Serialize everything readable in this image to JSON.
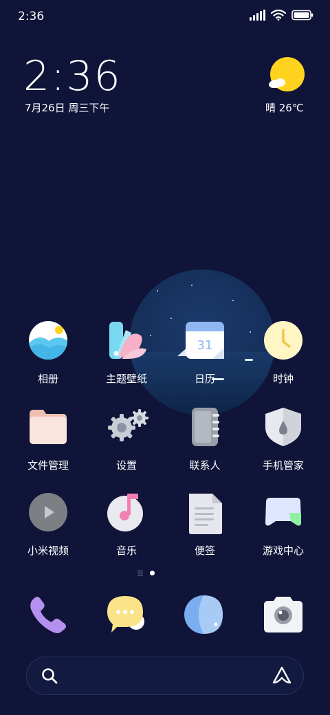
{
  "status_bar": {
    "time": "2:36"
  },
  "clock_widget": {
    "time": "2:36",
    "date": "7月26日 周三下午"
  },
  "weather": {
    "text": "晴 26℃",
    "icon": "sunny-cloud-icon"
  },
  "apps": [
    {
      "label": "相册",
      "icon": "gallery-icon"
    },
    {
      "label": "主题壁纸",
      "icon": "themes-icon"
    },
    {
      "label": "日历",
      "icon": "calendar-icon",
      "badge": "31"
    },
    {
      "label": "时钟",
      "icon": "clock-icon"
    },
    {
      "label": "文件管理",
      "icon": "folder-icon"
    },
    {
      "label": "设置",
      "icon": "settings-gear-icon"
    },
    {
      "label": "联系人",
      "icon": "contacts-icon"
    },
    {
      "label": "手机管家",
      "icon": "security-shield-icon"
    },
    {
      "label": "小米视频",
      "icon": "video-play-icon"
    },
    {
      "label": "音乐",
      "icon": "music-note-icon"
    },
    {
      "label": "便签",
      "icon": "notes-icon"
    },
    {
      "label": "游戏中心",
      "icon": "game-controller-icon"
    }
  ],
  "dock": [
    {
      "icon": "phone-icon"
    },
    {
      "icon": "messages-icon"
    },
    {
      "icon": "browser-icon"
    },
    {
      "icon": "camera-icon"
    }
  ],
  "page_indicator": {
    "current_page": 1,
    "pages": 1
  },
  "colors": {
    "background": "#0f1438",
    "text": "#ffffff",
    "sun": "#ffd21e"
  }
}
